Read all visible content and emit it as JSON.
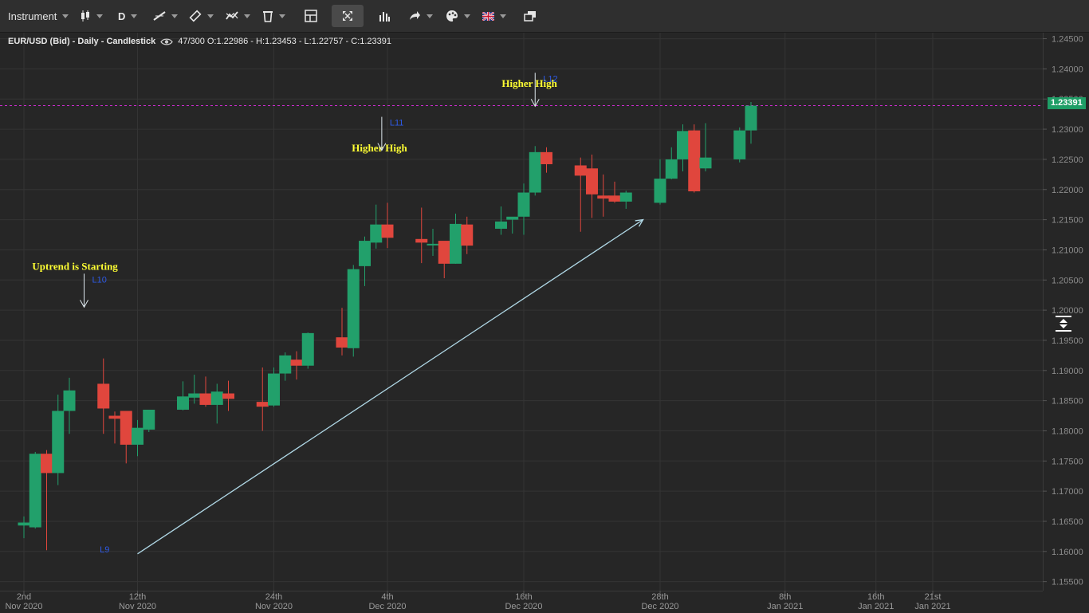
{
  "toolbar": {
    "instrument_label": "Instrument",
    "period_label": "D",
    "icons": [
      "candlestick-type-icon",
      "line-draw-icon",
      "ruler-icon",
      "indicator-icon",
      "trash-icon",
      "layout-icon",
      "fullscreen-icon",
      "bar-chart-icon",
      "share-icon",
      "palette-icon",
      "uk-flag-icon",
      "window-restore-icon"
    ]
  },
  "header": {
    "title": "EUR/USD (Bid) - Daily - Candlestick",
    "count": "47/300",
    "ohlc": "O:1.22986 - H:1.23453 - L:1.22757 - C:1.23391"
  },
  "price_tag": "1.23391",
  "colors": {
    "up": "#22a06b",
    "down": "#e0463d",
    "trendline": "#b0d8e6",
    "price_line": "#d02bd2",
    "annotation_text": "#ffff33",
    "label_blue": "#2e5ae6"
  },
  "chart_data": {
    "type": "candlestick",
    "ylim": [
      1.1535,
      1.246
    ],
    "y_ticks": [
      "1.24500",
      "1.24000",
      "1.23500",
      "1.23000",
      "1.22500",
      "1.22000",
      "1.21500",
      "1.21000",
      "1.20500",
      "1.20000",
      "1.19500",
      "1.19000",
      "1.18500",
      "1.18000",
      "1.17500",
      "1.17000",
      "1.16500",
      "1.16000",
      "1.15500"
    ],
    "x_ticks": [
      {
        "day": 2,
        "line1": "2nd",
        "line2": "Nov 2020"
      },
      {
        "day": 12,
        "line1": "12th",
        "line2": "Nov 2020"
      },
      {
        "day": 24,
        "line1": "24th",
        "line2": "Nov 2020"
      },
      {
        "day": 34,
        "line1": "4th",
        "line2": "Dec 2020"
      },
      {
        "day": 46,
        "line1": "16th",
        "line2": "Dec 2020"
      },
      {
        "day": 58,
        "line1": "28th",
        "line2": "Dec 2020"
      },
      {
        "day": 69,
        "line1": "8th",
        "line2": "Jan 2021"
      },
      {
        "day": 77,
        "line1": "16th",
        "line2": "Jan 2021"
      },
      {
        "day": 82,
        "line1": "21st",
        "line2": "Jan 2021"
      }
    ],
    "candles": [
      {
        "day": 2,
        "o": 1.1643,
        "h": 1.1658,
        "l": 1.1622,
        "c": 1.1648
      },
      {
        "day": 3,
        "o": 1.164,
        "h": 1.1765,
        "l": 1.1638,
        "c": 1.1762
      },
      {
        "day": 4,
        "o": 1.1762,
        "h": 1.1768,
        "l": 1.1602,
        "c": 1.173
      },
      {
        "day": 5,
        "o": 1.173,
        "h": 1.186,
        "l": 1.171,
        "c": 1.1833
      },
      {
        "day": 6,
        "o": 1.1833,
        "h": 1.1888,
        "l": 1.1795,
        "c": 1.1867
      },
      {
        "day": 9,
        "o": 1.1878,
        "h": 1.192,
        "l": 1.1795,
        "c": 1.1837
      },
      {
        "day": 10,
        "o": 1.1825,
        "h": 1.1832,
        "l": 1.1779,
        "c": 1.182
      },
      {
        "day": 11,
        "o": 1.1833,
        "h": 1.1832,
        "l": 1.1746,
        "c": 1.1777
      },
      {
        "day": 12,
        "o": 1.1777,
        "h": 1.1818,
        "l": 1.1758,
        "c": 1.1805
      },
      {
        "day": 13,
        "o": 1.1802,
        "h": 1.183,
        "l": 1.1798,
        "c": 1.1835
      },
      {
        "day": 16,
        "o": 1.1835,
        "h": 1.1882,
        "l": 1.1834,
        "c": 1.1857
      },
      {
        "day": 17,
        "o": 1.1855,
        "h": 1.1893,
        "l": 1.1845,
        "c": 1.1862
      },
      {
        "day": 18,
        "o": 1.1862,
        "h": 1.189,
        "l": 1.184,
        "c": 1.1843
      },
      {
        "day": 19,
        "o": 1.1843,
        "h": 1.1878,
        "l": 1.1812,
        "c": 1.1865
      },
      {
        "day": 20,
        "o": 1.1862,
        "h": 1.1883,
        "l": 1.1833,
        "c": 1.1853
      },
      {
        "day": 23,
        "o": 1.1848,
        "h": 1.1905,
        "l": 1.18,
        "c": 1.184
      },
      {
        "day": 24,
        "o": 1.1842,
        "h": 1.1905,
        "l": 1.184,
        "c": 1.1895
      },
      {
        "day": 25,
        "o": 1.1895,
        "h": 1.193,
        "l": 1.1883,
        "c": 1.1925
      },
      {
        "day": 26,
        "o": 1.1918,
        "h": 1.1932,
        "l": 1.1885,
        "c": 1.1908
      },
      {
        "day": 27,
        "o": 1.1908,
        "h": 1.1963,
        "l": 1.1903,
        "c": 1.1962
      },
      {
        "day": 30,
        "o": 1.1955,
        "h": 1.2004,
        "l": 1.1925,
        "c": 1.1938
      },
      {
        "day": 31,
        "o": 1.1937,
        "h": 1.2075,
        "l": 1.1923,
        "c": 1.2068
      },
      {
        "day": 32,
        "o": 1.2073,
        "h": 1.2122,
        "l": 1.204,
        "c": 1.2115
      },
      {
        "day": 33,
        "o": 1.2112,
        "h": 1.2175,
        "l": 1.2102,
        "c": 1.2142
      },
      {
        "day": 34,
        "o": 1.2142,
        "h": 1.2178,
        "l": 1.2103,
        "c": 1.212
      },
      {
        "day": 37,
        "o": 1.2118,
        "h": 1.217,
        "l": 1.2078,
        "c": 1.2112
      },
      {
        "day": 38,
        "o": 1.2108,
        "h": 1.2135,
        "l": 1.209,
        "c": 1.211
      },
      {
        "day": 39,
        "o": 1.2115,
        "h": 1.2112,
        "l": 1.2053,
        "c": 1.2077
      },
      {
        "day": 40,
        "o": 1.2077,
        "h": 1.216,
        "l": 1.2077,
        "c": 1.2143
      },
      {
        "day": 41,
        "o": 1.2142,
        "h": 1.2155,
        "l": 1.2093,
        "c": 1.2107
      },
      {
        "day": 44,
        "o": 1.2135,
        "h": 1.2172,
        "l": 1.2125,
        "c": 1.2147
      },
      {
        "day": 45,
        "o": 1.215,
        "h": 1.2153,
        "l": 1.2127,
        "c": 1.2155
      },
      {
        "day": 46,
        "o": 1.2155,
        "h": 1.221,
        "l": 1.2125,
        "c": 1.2195
      },
      {
        "day": 47,
        "o": 1.2195,
        "h": 1.2272,
        "l": 1.219,
        "c": 1.2262
      },
      {
        "day": 48,
        "o": 1.2262,
        "h": 1.227,
        "l": 1.2228,
        "c": 1.2242
      },
      {
        "day": 51,
        "o": 1.224,
        "h": 1.2253,
        "l": 1.213,
        "c": 1.2223
      },
      {
        "day": 52,
        "o": 1.2235,
        "h": 1.2258,
        "l": 1.2153,
        "c": 1.2192
      },
      {
        "day": 53,
        "o": 1.219,
        "h": 1.2225,
        "l": 1.2155,
        "c": 1.2185
      },
      {
        "day": 54,
        "o": 1.219,
        "h": 1.2213,
        "l": 1.2178,
        "c": 1.218
      },
      {
        "day": 55,
        "o": 1.218,
        "h": 1.2198,
        "l": 1.2168,
        "c": 1.2195
      },
      {
        "day": 58,
        "o": 1.2178,
        "h": 1.225,
        "l": 1.2175,
        "c": 1.2218
      },
      {
        "day": 59,
        "o": 1.2218,
        "h": 1.227,
        "l": 1.2217,
        "c": 1.225
      },
      {
        "day": 60,
        "o": 1.225,
        "h": 1.2308,
        "l": 1.223,
        "c": 1.2297
      },
      {
        "day": 61,
        "o": 1.2298,
        "h": 1.2308,
        "l": 1.2195,
        "c": 1.2197
      },
      {
        "day": 62,
        "o": 1.2235,
        "h": 1.231,
        "l": 1.223,
        "c": 1.2253
      },
      {
        "day": 65,
        "o": 1.225,
        "h": 1.2303,
        "l": 1.2245,
        "c": 1.2298
      },
      {
        "day": 66,
        "o": 1.2298,
        "h": 1.2345,
        "l": 1.2276,
        "c": 1.2339
      }
    ],
    "annotations": [
      {
        "text": "Uptrend is Starting",
        "day": 6.5,
        "price": 1.2067
      },
      {
        "text": "Higher High",
        "day": 33.3,
        "price": 1.2263
      },
      {
        "text": "Higher High",
        "day": 46.5,
        "price": 1.237
      }
    ],
    "markers": [
      {
        "label": "L10",
        "day": 7.3,
        "price": 1.2005
      },
      {
        "label": "L11",
        "day": 33.5,
        "price": 1.2265
      },
      {
        "label": "L12",
        "day": 47.0,
        "price": 1.2338
      },
      {
        "label": "L9",
        "day": 10.1,
        "price": 1.1604
      }
    ],
    "trendline": {
      "from": {
        "day": 12.0,
        "price": 1.1596
      },
      "to": {
        "day": 56.5,
        "price": 1.215
      }
    },
    "current_price": 1.23391
  }
}
